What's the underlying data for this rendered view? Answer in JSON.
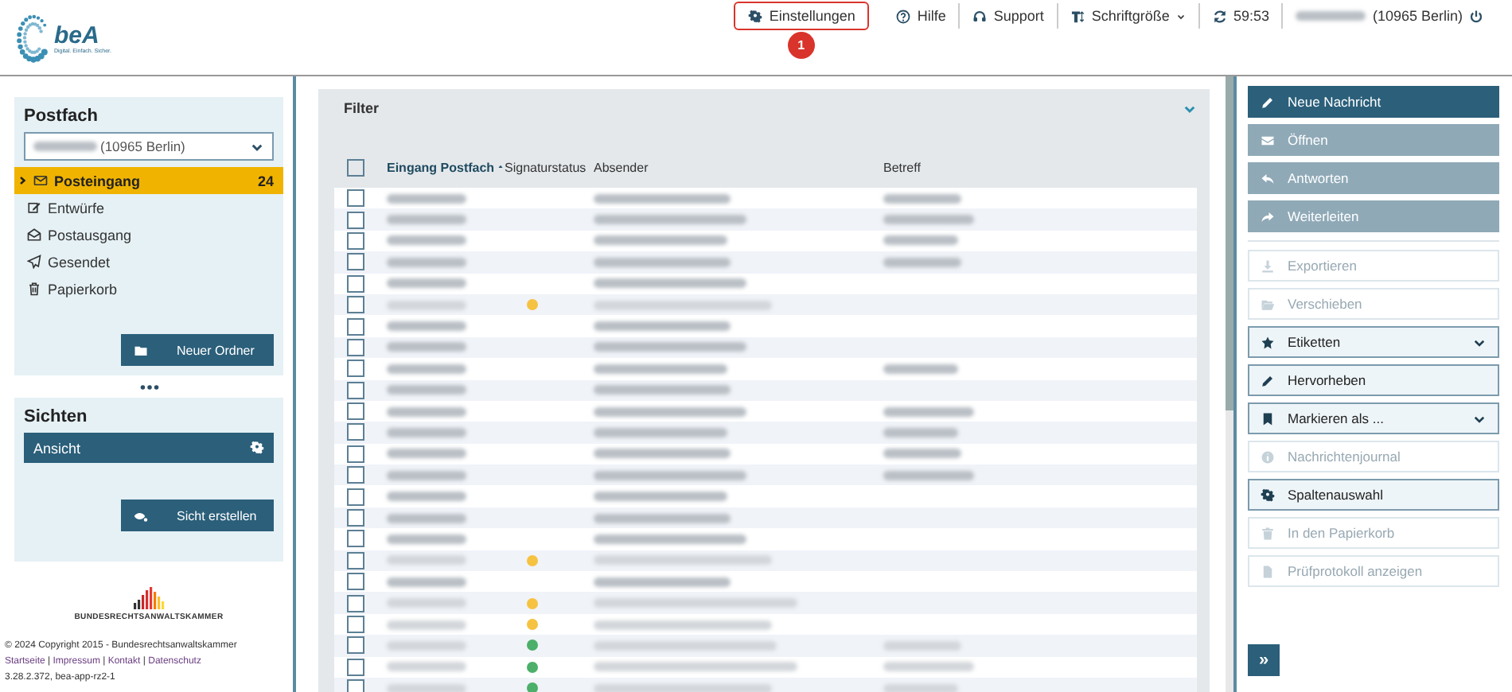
{
  "logo": {
    "text": "beA",
    "tagline": "Digital. Einfach. Sicher."
  },
  "header_nav": [
    {
      "label": "Einstellungen",
      "highlighted": true,
      "badge": "1",
      "dropdown": false
    },
    {
      "label": "Hilfe",
      "highlighted": false,
      "dropdown": false
    },
    {
      "label": "Support",
      "highlighted": false,
      "dropdown": false
    },
    {
      "label": "Schriftgröße",
      "highlighted": false,
      "dropdown": true
    },
    {
      "label": "59:53",
      "highlighted": false,
      "dropdown": false
    },
    {
      "label": "(10965 Berlin)",
      "highlighted": false,
      "dropdown": false,
      "redacted_prefix": true
    }
  ],
  "postfach": {
    "title": "Postfach",
    "account": "(10965 Berlin)",
    "folders": [
      {
        "label": "Posteingang",
        "count": "24",
        "selected": true
      },
      {
        "label": "Entwürfe",
        "selected": false
      },
      {
        "label": "Postausgang",
        "selected": false
      },
      {
        "label": "Gesendet",
        "selected": false
      },
      {
        "label": "Papierkorb",
        "selected": false
      }
    ],
    "new_folder_button": "Neuer Ordner"
  },
  "sichten": {
    "title": "Sichten",
    "view": "Ansicht",
    "create_button": "Sicht erstellen"
  },
  "footer": {
    "brand": "BUNDESRECHTSANWALTSKAMMER",
    "copyright": "© 2024 Copyright 2015 - Bundesrechtsanwaltskammer",
    "links": [
      "Startseite",
      "Impressum",
      "Kontakt",
      "Datenschutz"
    ],
    "separator": "|",
    "version": "3.28.2.372, bea-app-rz2-1"
  },
  "filter": {
    "title": "Filter",
    "expanded": false
  },
  "table": {
    "all_selected": false,
    "columns": [
      "Eingang Postfach",
      "Signaturstatus",
      "Absender",
      "Betreff"
    ],
    "rows": [
      {
        "faded": false,
        "subject_shown": true
      },
      {
        "faded": false,
        "subject_shown": true
      },
      {
        "faded": false,
        "subject_shown": true
      },
      {
        "faded": false,
        "subject_shown": true
      },
      {
        "faded": false,
        "subject_shown": false
      },
      {
        "faded": true,
        "subject_shown": false,
        "color": "#f5c242"
      },
      {
        "faded": false,
        "subject_shown": false
      },
      {
        "faded": false,
        "subject_shown": false
      },
      {
        "faded": false,
        "subject_shown": true
      },
      {
        "faded": false,
        "subject_shown": false
      },
      {
        "faded": false,
        "subject_shown": true
      },
      {
        "faded": false,
        "subject_shown": true
      },
      {
        "faded": false,
        "subject_shown": true
      },
      {
        "faded": false,
        "subject_shown": true
      },
      {
        "faded": false,
        "subject_shown": false
      },
      {
        "faded": false,
        "subject_shown": false
      },
      {
        "faded": false,
        "subject_shown": false
      },
      {
        "faded": true,
        "subject_shown": false,
        "color": "#f5c242"
      },
      {
        "faded": false,
        "subject_shown": false
      },
      {
        "faded": true,
        "subject_shown": false,
        "color": "#f5c242"
      },
      {
        "faded": true,
        "subject_shown": false,
        "color": "#f5c242"
      },
      {
        "faded": true,
        "subject_shown": true,
        "color": "#4caf6a"
      },
      {
        "faded": true,
        "subject_shown": true,
        "color": "#4caf6a"
      },
      {
        "faded": true,
        "subject_shown": true,
        "color": "#4caf6a"
      }
    ]
  },
  "actions": [
    {
      "label": "Neue Nachricht",
      "kind": "filled",
      "disabled": false,
      "dropdown": false
    },
    {
      "label": "Öffnen",
      "kind": "filled",
      "disabled": true,
      "dropdown": false
    },
    {
      "label": "Antworten",
      "kind": "filled",
      "disabled": true,
      "dropdown": false
    },
    {
      "label": "Weiterleiten",
      "kind": "filled",
      "disabled": true,
      "dropdown": false
    },
    {
      "label": "Exportieren",
      "kind": "outline",
      "disabled": true,
      "dropdown": false
    },
    {
      "label": "Verschieben",
      "kind": "outline",
      "disabled": true,
      "dropdown": false
    },
    {
      "label": "Etiketten",
      "kind": "outline",
      "disabled": false,
      "dropdown": true
    },
    {
      "label": "Hervorheben",
      "kind": "outline",
      "disabled": false,
      "dropdown": false
    },
    {
      "label": "Markieren als ...",
      "kind": "outline",
      "disabled": false,
      "dropdown": true
    },
    {
      "label": "Nachrichtenjournal",
      "kind": "outline",
      "disabled": true,
      "dropdown": false
    },
    {
      "label": "Spaltenauswahl",
      "kind": "outline",
      "disabled": false,
      "dropdown": false
    },
    {
      "label": "In den Papierkorb",
      "kind": "outline",
      "disabled": true,
      "dropdown": false
    },
    {
      "label": "Prüfprotokoll anzeigen",
      "kind": "outline",
      "disabled": true,
      "dropdown": false
    }
  ],
  "expand_button": "»"
}
